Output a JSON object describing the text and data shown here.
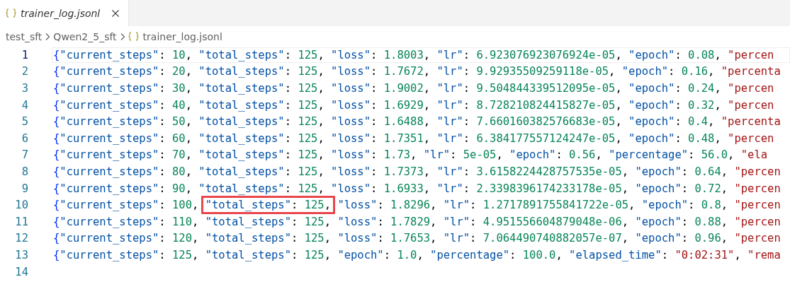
{
  "tabs": [
    {
      "label": "trainer_log.jsonl",
      "selected": true,
      "italic": true
    }
  ],
  "breadcrumb": [
    "test_sft",
    "Qwen2_5_sft",
    "trainer_log.jsonl"
  ],
  "editor": {
    "lines": [
      {
        "number": "1",
        "active": true,
        "segments": [
          {
            "text": "{\"current_steps\": 10, \"total_steps\": 125, \"loss\": 1.8003, \"lr\": 6.923076923076924e-05, \"epoch\": 0.08, \"percen",
            "highlighted": false
          }
        ]
      },
      {
        "number": "2",
        "active": false,
        "segments": [
          {
            "text": "{\"current_steps\": 20, \"total_steps\": 125, \"loss\": 1.7672, \"lr\": 9.92935509259118e-05, \"epoch\": 0.16, \"percenta",
            "highlighted": false
          }
        ]
      },
      {
        "number": "3",
        "active": false,
        "segments": [
          {
            "text": "{\"current_steps\": 30, \"total_steps\": 125, \"loss\": 1.9002, \"lr\": 9.504844339512095e-05, \"epoch\": 0.24, \"percen",
            "highlighted": false
          }
        ]
      },
      {
        "number": "4",
        "active": false,
        "segments": [
          {
            "text": "{\"current_steps\": 40, \"total_steps\": 125, \"loss\": 1.6929, \"lr\": 8.728210824415827e-05, \"epoch\": 0.32, \"percen",
            "highlighted": false
          }
        ]
      },
      {
        "number": "5",
        "active": false,
        "segments": [
          {
            "text": "{\"current_steps\": 50, \"total_steps\": 125, \"loss\": 1.6488, \"lr\": 7.660160382576683e-05, \"epoch\": 0.4, \"percenta",
            "highlighted": false
          }
        ]
      },
      {
        "number": "6",
        "active": false,
        "segments": [
          {
            "text": "{\"current_steps\": 60, \"total_steps\": 125, \"loss\": 1.7351, \"lr\": 6.384177557124247e-05, \"epoch\": 0.48, \"percen",
            "highlighted": false
          }
        ]
      },
      {
        "number": "7",
        "active": false,
        "segments": [
          {
            "text": "{\"current_steps\": 70, \"total_steps\": 125, \"loss\": 1.73, \"lr\": 5e-05, \"epoch\": 0.56, \"percentage\": 56.0, \"ela",
            "highlighted": false
          }
        ]
      },
      {
        "number": "8",
        "active": false,
        "segments": [
          {
            "text": "{\"current_steps\": 80, \"total_steps\": 125, \"loss\": 1.7373, \"lr\": 3.6158224428757535e-05, \"epoch\": 0.64, \"percen",
            "highlighted": false
          }
        ]
      },
      {
        "number": "9",
        "active": false,
        "segments": [
          {
            "text": "{\"current_steps\": 90, \"total_steps\": 125, \"loss\": 1.6933, \"lr\": 2.3398396174233178e-05, \"epoch\": 0.72, \"percen",
            "highlighted": false
          }
        ]
      },
      {
        "number": "10",
        "active": false,
        "segments": [
          {
            "text": "{\"current_steps\": 100, ",
            "highlighted": false
          },
          {
            "text": "\"total_steps\": 125,",
            "highlighted": true
          },
          {
            "text": " \"loss\": 1.8296, \"lr\": 1.2717891755841722e-05, \"epoch\": 0.8, \"percen",
            "highlighted": false
          }
        ]
      },
      {
        "number": "11",
        "active": false,
        "segments": [
          {
            "text": "{\"current_steps\": 110, \"total_steps\": 125, \"loss\": 1.7829, \"lr\": 4.951556604879048e-06, \"epoch\": 0.88, \"percen",
            "highlighted": false
          }
        ]
      },
      {
        "number": "12",
        "active": false,
        "segments": [
          {
            "text": "{\"current_steps\": 120, \"total_steps\": 125, \"loss\": 1.7653, \"lr\": 7.064490740882057e-07, \"epoch\": 0.96, \"percen",
            "highlighted": false
          }
        ]
      },
      {
        "number": "13",
        "active": false,
        "segments": [
          {
            "text": "{\"current_steps\": 125, \"total_steps\": 125, \"epoch\": 1.0, \"percentage\": 100.0, \"elapsed_time\": \"0:02:31\", \"rema",
            "highlighted": false
          }
        ]
      },
      {
        "number": "14",
        "active": false
      }
    ]
  }
}
